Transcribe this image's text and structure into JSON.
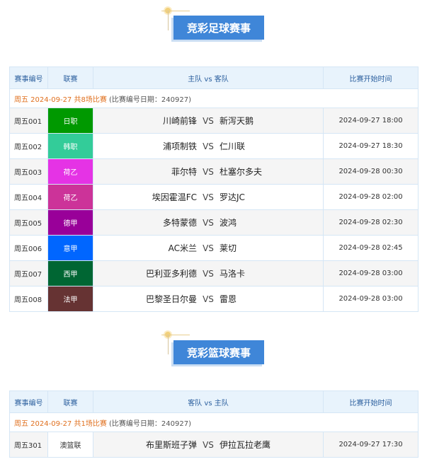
{
  "sections": [
    {
      "title": "竞彩足球赛事",
      "headers": [
        "赛事编号",
        "联赛",
        "主队 vs 客队",
        "比赛开始时间"
      ],
      "info_highlight": "周五 2024-09-27 共8场比赛",
      "info_rest": " (比赛编号日期：240927)",
      "rows": [
        {
          "num": "周五001",
          "league": "日职",
          "color": "#009900",
          "home": "川崎前锋",
          "vs": "VS",
          "away": "新泻天鹅",
          "time": "2024-09-27 18:00"
        },
        {
          "num": "周五002",
          "league": "韩职",
          "color": "#33cc99",
          "home": "浦项制铁",
          "vs": "VS",
          "away": "仁川联",
          "time": "2024-09-27 18:30"
        },
        {
          "num": "周五003",
          "league": "荷乙",
          "color": "#e533e5",
          "home": "菲尔特",
          "vs": "VS",
          "away": "杜塞尔多夫",
          "time": "2024-09-28 00:30"
        },
        {
          "num": "周五004",
          "league": "荷乙",
          "color": "#cc3399",
          "home": "埃因霍温FC",
          "vs": "VS",
          "away": "罗达JC",
          "time": "2024-09-28 02:00"
        },
        {
          "num": "周五005",
          "league": "德甲",
          "color": "#990099",
          "home": "多特蒙德",
          "vs": "VS",
          "away": "波鸿",
          "time": "2024-09-28 02:30"
        },
        {
          "num": "周五006",
          "league": "意甲",
          "color": "#0066ff",
          "home": "AC米兰",
          "vs": "VS",
          "away": "莱切",
          "time": "2024-09-28 02:45"
        },
        {
          "num": "周五007",
          "league": "西甲",
          "color": "#006633",
          "home": "巴利亚多利德",
          "vs": "VS",
          "away": "马洛卡",
          "time": "2024-09-28 03:00"
        },
        {
          "num": "周五008",
          "league": "法甲",
          "color": "#663333",
          "home": "巴黎圣日尔曼",
          "vs": "VS",
          "away": "雷恩",
          "time": "2024-09-28 03:00"
        }
      ]
    },
    {
      "title": "竞彩篮球赛事",
      "headers": [
        "赛事编号",
        "联赛",
        "客队 vs 主队",
        "比赛开始时间"
      ],
      "info_highlight": "周五 2024-09-27 共1场比赛",
      "info_rest": " (比赛编号日期：240927)",
      "rows": [
        {
          "num": "周五301",
          "league": "澳篮联",
          "color": "",
          "home": "布里斯班子弹",
          "vs": "VS",
          "away": "伊拉瓦拉老鹰",
          "time": "2024-09-27 17:30"
        }
      ]
    }
  ]
}
